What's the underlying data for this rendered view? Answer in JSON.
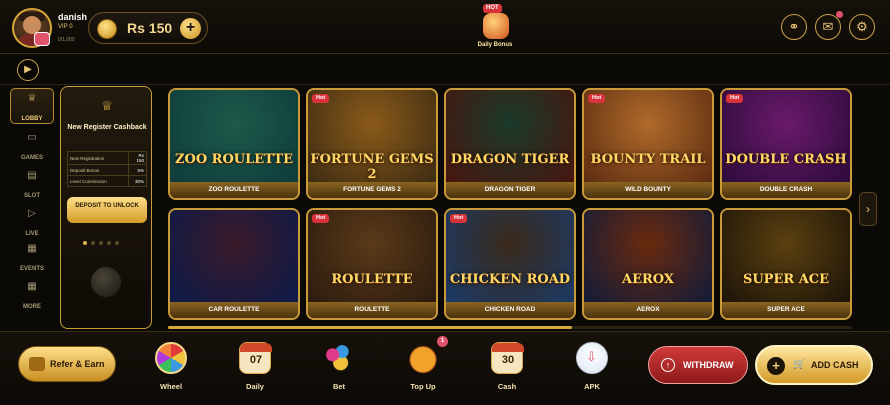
{
  "header": {
    "username": "danish",
    "vip_level": "VIP 0",
    "vip_progress": "0/1,000",
    "balance": "Rs 150",
    "daily_bonus_label": "Daily Bonus",
    "daily_bonus_badge": "HOT"
  },
  "leftnav": {
    "items": [
      {
        "label": "LOBBY",
        "icon": "crown-icon"
      },
      {
        "label": "GAMES",
        "icon": "card-icon"
      },
      {
        "label": "SLOT",
        "icon": "slot-icon"
      },
      {
        "label": "LIVE",
        "icon": "play-icon"
      },
      {
        "label": "EVENTS",
        "icon": "calendar-icon"
      },
      {
        "label": "MORE",
        "icon": "grid-icon"
      }
    ]
  },
  "promo": {
    "title": "New Register Cashback",
    "rows": [
      {
        "label": "New Registration",
        "value": "Rs 150"
      },
      {
        "label": "Deposit Bonus",
        "value": "5%"
      },
      {
        "label": "Level Commission",
        "value": "30%"
      }
    ],
    "button": "DEPOSIT TO UNLOCK",
    "page_count": 5,
    "active_page": 1
  },
  "games": [
    {
      "name": "ZOO ROULETTE",
      "art": "ZOO ROULETTE",
      "hot": false,
      "colors": [
        "#0e3a3a",
        "#1c5a4a"
      ]
    },
    {
      "name": "FORTUNE GEMS 2",
      "art": "FORTUNE GEMS 2",
      "hot": true,
      "colors": [
        "#3a2a12",
        "#8a5a1a"
      ]
    },
    {
      "name": "DRAGON TIGER",
      "art": "DRAGON TIGER",
      "hot": false,
      "colors": [
        "#4a140e",
        "#1a3a2a"
      ]
    },
    {
      "name": "WILD BOUNTY",
      "art": "BOUNTY TRAIL",
      "hot": true,
      "colors": [
        "#5a2a10",
        "#b06a2a"
      ]
    },
    {
      "name": "DOUBLE CRASH",
      "art": "DOUBLE CRASH",
      "hot": true,
      "colors": [
        "#2a0a3a",
        "#6a1a6a"
      ]
    },
    {
      "name": "CAR ROULETTE",
      "art": "",
      "hot": false,
      "colors": [
        "#0a1a4a",
        "#3a1a2a"
      ]
    },
    {
      "name": "ROULETTE",
      "art": "ROULETTE",
      "hot": true,
      "colors": [
        "#2a1a0e",
        "#5a3a1a"
      ]
    },
    {
      "name": "CHICKEN ROAD",
      "art": "CHICKEN ROAD",
      "hot": true,
      "colors": [
        "#1a3a6a",
        "#3a2a1a"
      ]
    },
    {
      "name": "AEROX",
      "art": "AEROX",
      "hot": false,
      "colors": [
        "#0e1a3a",
        "#6a2a0e"
      ]
    },
    {
      "name": "SUPER ACE",
      "art": "SUPER ACE",
      "hot": false,
      "colors": [
        "#1a1208",
        "#5a4010"
      ]
    }
  ],
  "hot_label": "Hot",
  "bottom": {
    "refer": "Refer & Earn",
    "items": [
      {
        "label": "Wheel",
        "icon": "wheel-icon"
      },
      {
        "label": "Daily",
        "icon": "calendar-icon",
        "number": "07"
      },
      {
        "label": "Bet",
        "icon": "chips-icon"
      },
      {
        "label": "Top Up",
        "icon": "gift-icon"
      },
      {
        "label": "Cash",
        "icon": "calendar-icon",
        "number": "30"
      },
      {
        "label": "APK",
        "icon": "download-icon"
      }
    ],
    "topup_badge": "1",
    "withdraw": "WITHDRAW",
    "add_cash": "ADD CASH"
  },
  "scroll_progress": 0.59
}
